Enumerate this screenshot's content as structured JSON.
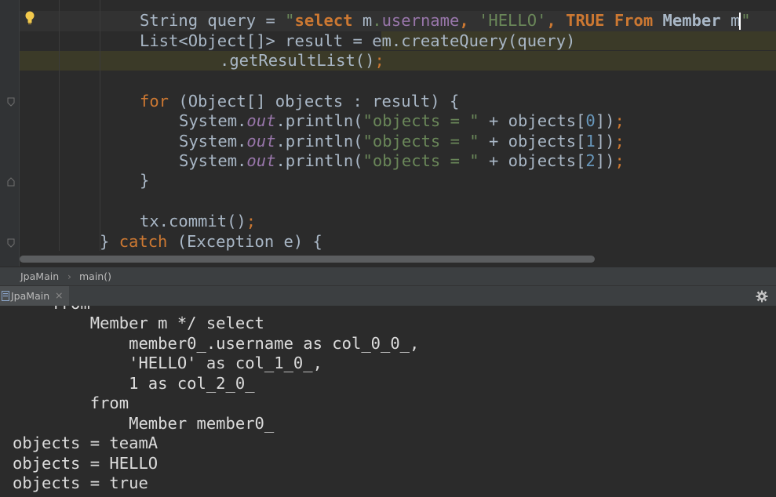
{
  "editor": {
    "line1": {
      "a": "String query = ",
      "q1": "\"",
      "select": "select",
      "m": " m",
      "dot": ".",
      "username": "username",
      "comma1": ", ",
      "hello": "'HELLO'",
      "comma2": ", ",
      "trueKw": "TRUE",
      "sp1": " ",
      "fromKw": "From",
      "member": " Member ",
      "mAlias": "m",
      "q2": "\""
    },
    "line2": {
      "a": "List<Object[]> result = ",
      "b": "em.createQuery(query)"
    },
    "line3": {
      "a": ".getResultList()",
      "b": ";"
    },
    "line5": {
      "kw": "for",
      "rest": " (Object[] objects : result) {"
    },
    "print_lines": [
      {
        "pre": "System.",
        "out": "out",
        "mid": ".println(",
        "str": "\"objects = \"",
        "plus": " + objects[",
        "idx": "0",
        "end": "])",
        "semi": ";"
      },
      {
        "pre": "System.",
        "out": "out",
        "mid": ".println(",
        "str": "\"objects = \"",
        "plus": " + objects[",
        "idx": "1",
        "end": "])",
        "semi": ";"
      },
      {
        "pre": "System.",
        "out": "out",
        "mid": ".println(",
        "str": "\"objects = \"",
        "plus": " + objects[",
        "idx": "2",
        "end": "])",
        "semi": ";"
      }
    ],
    "line9": "}",
    "line11": {
      "a": "tx.commit()",
      "b": ";"
    },
    "line12": {
      "a": "} ",
      "kw": "catch",
      "b": " (Exception e) {"
    }
  },
  "breadcrumb": {
    "class_name": "JpaMain",
    "separator": "›",
    "method": "main()"
  },
  "run_tab": {
    "label": "JpaMain",
    "close": "×"
  },
  "console": {
    "lines": [
      "    from",
      "        Member m */ select",
      "            member0_.username as col_0_0_,",
      "            'HELLO' as col_1_0_,",
      "            1 as col_2_0_",
      "        from",
      "            Member member0_",
      "objects = teamA",
      "objects = HELLO",
      "objects = true"
    ]
  },
  "colors": {
    "keyword": "#cc7832",
    "string": "#6a8759",
    "field": "#9876aa",
    "number": "#6897bb",
    "text": "#a9b7c6",
    "background": "#2b2b2b",
    "toolbar": "#3c3f41"
  }
}
